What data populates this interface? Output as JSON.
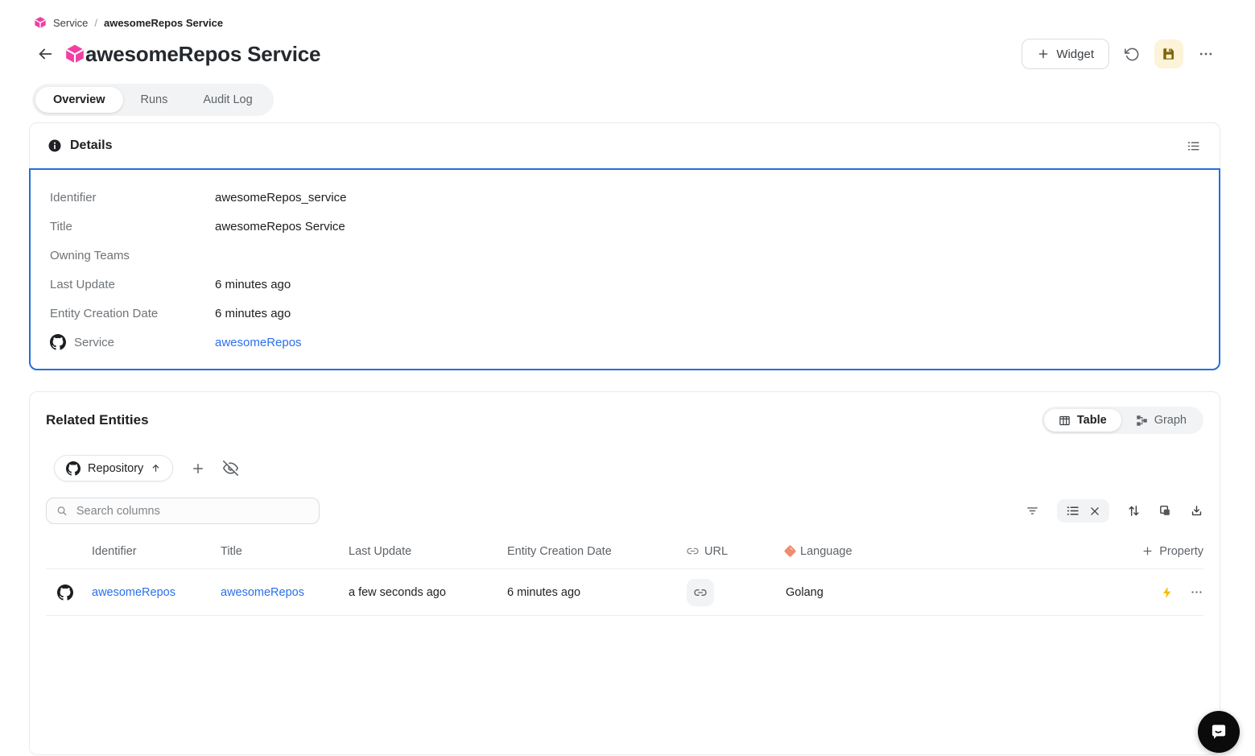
{
  "breadcrumb": {
    "root": "Service",
    "separator": "/",
    "current": "awesomeRepos Service"
  },
  "header": {
    "title": "awesomeRepos Service",
    "widget_label": "Widget"
  },
  "tabs": {
    "overview": "Overview",
    "runs": "Runs",
    "audit_log": "Audit Log"
  },
  "details": {
    "title": "Details",
    "rows": [
      {
        "label": "Identifier",
        "value": "awesomeRepos_service"
      },
      {
        "label": "Title",
        "value": "awesomeRepos Service"
      },
      {
        "label": "Owning Teams",
        "value": ""
      },
      {
        "label": "Last Update",
        "value": "6 minutes ago"
      },
      {
        "label": "Entity Creation Date",
        "value": "6 minutes ago"
      },
      {
        "label": "Service",
        "value": "awesomeRepos"
      }
    ]
  },
  "related": {
    "title": "Related Entities",
    "table_label": "Table",
    "graph_label": "Graph",
    "entity_filter": "Repository",
    "search_placeholder": "Search columns",
    "columns": {
      "identifier": "Identifier",
      "title": "Title",
      "last_update": "Last Update",
      "creation_date": "Entity Creation Date",
      "url": "URL",
      "language": "Language"
    },
    "add_property_label": "Property",
    "rows": [
      {
        "identifier": "awesomeRepos",
        "title": "awesomeRepos",
        "last_update": "a few seconds ago",
        "creation_date": "6 minutes ago",
        "language": "Golang"
      }
    ]
  },
  "icons": {
    "cube": "service-blueprint-cube",
    "github": "github-mark",
    "save": "save-floppy",
    "undo": "undo-rotate-ccw"
  },
  "colors": {
    "accent_pink": "#f23fa4",
    "link_blue": "#2970ed",
    "selection_blue": "#2370dd",
    "save_bg": "#fcf3d9",
    "save_icon": "#7d6708",
    "bolt_yellow": "#fbbc04",
    "language_icon": "#f28b6e"
  }
}
